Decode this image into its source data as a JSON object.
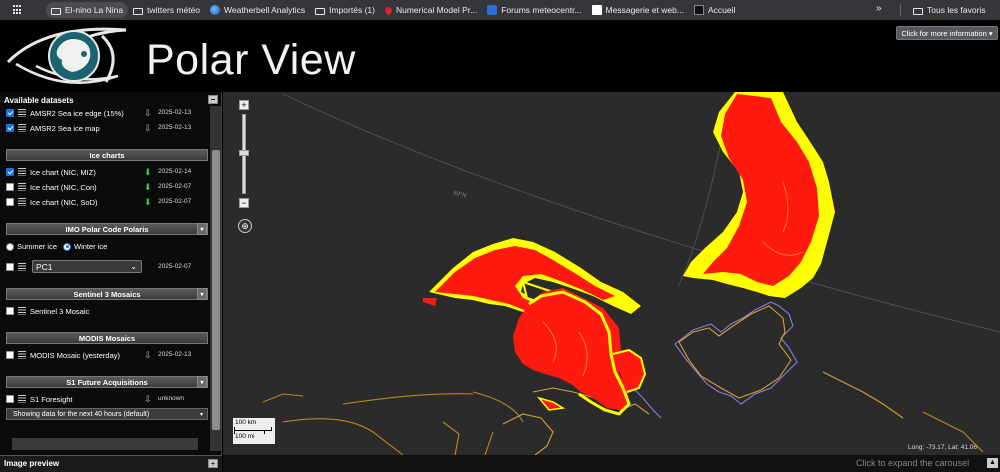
{
  "bookmarks": [
    {
      "label": "",
      "icon": "apps-grid-icon"
    },
    {
      "label": "El-nino La Nina",
      "icon": "folder-icon"
    },
    {
      "label": "twitters météo",
      "icon": "folder-icon"
    },
    {
      "label": "Weatherbell Analytics",
      "icon": "globe-icon"
    },
    {
      "label": "Importés (1)",
      "icon": "folder-icon"
    },
    {
      "label": "Numerical Model Pr...",
      "icon": "drop-icon"
    },
    {
      "label": "Forums meteocentr...",
      "icon": "mc-icon"
    },
    {
      "label": "Messagerie et web...",
      "icon": "owa-icon"
    },
    {
      "label": "Accueil",
      "icon": "wh-icon"
    }
  ],
  "bookmarks_overflow": "»",
  "all_favorites": "Tous les favoris",
  "header": {
    "brand": "Polar View",
    "info_button": "Click for more information ▾"
  },
  "sidebar": {
    "title": "Available datasets",
    "top_datasets": [
      {
        "name": "AMSR2 Sea ice edge (15%)",
        "date": "2025-02-13",
        "checked": true
      },
      {
        "name": "AMSR2 Sea ice map",
        "date": "2025-02-13",
        "checked": true
      }
    ],
    "ice_charts": {
      "title": "Ice charts",
      "items": [
        {
          "name": "Ice chart (NIC, MIZ)",
          "date": "2025-02-14",
          "checked": true
        },
        {
          "name": "Ice chart (NIC, Con)",
          "date": "2025-02-07",
          "checked": false
        },
        {
          "name": "Ice chart (NIC, SoD)",
          "date": "2025-02-07",
          "checked": false
        }
      ]
    },
    "imo": {
      "title": "IMO Polar Code Polaris",
      "summer_label": "Summer ice",
      "winter_label": "Winter ice",
      "select_value": "PC1",
      "date": "2025-02-07"
    },
    "sentinel": {
      "title": "Sentinel 3 Mosaics",
      "item": "Sentinel 3 Mosaic"
    },
    "modis": {
      "title": "MODIS Mosaics",
      "item": "MODIS Mosaic (yesterday)",
      "date": "2025-02-13"
    },
    "s1": {
      "title": "S1 Future Acquisitions",
      "item": "S1 Foresight",
      "date": "unknown",
      "showing": "Showing data for the next 40 hours (default)"
    }
  },
  "preview": {
    "title": "Image preview",
    "plus": "+"
  },
  "map": {
    "graticule_label": "50°N",
    "scale_km": "100 km",
    "scale_mi": "100 mi",
    "coords": "Long: -73.17, Lat: 41.06",
    "zoom_in": "+",
    "zoom_out": "−"
  },
  "carousel": {
    "text": "Click to expand the carousel",
    "toggle": "▲"
  },
  "colors": {
    "ice_fill": "#ff1a10",
    "ice_edge": "#ffff00",
    "map_bg": "#2b2b2b",
    "accent": "#1a73e8"
  }
}
